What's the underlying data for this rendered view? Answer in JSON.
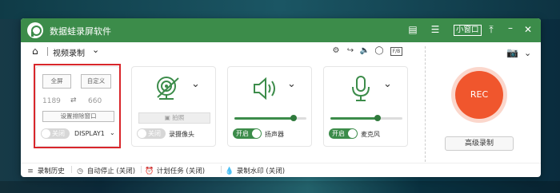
{
  "app": {
    "title": "数据蛙录屏软件",
    "mini_label": "小窗口"
  },
  "titlebar_icons": [
    "message-icon",
    "menu-icon",
    "pin-icon",
    "minimize-icon",
    "close-icon"
  ],
  "mode": {
    "label": "视频录制"
  },
  "toolbar_icons": [
    "settings-icon",
    "export-icon",
    "speaker-icon",
    "mouse-icon",
    "fb-icon"
  ],
  "toolbar_fb": "F/B",
  "screen_card": {
    "fullscreen_label": "全屏",
    "custom_label": "自定义",
    "width": "1189",
    "height": "660",
    "exclude_label": "设置排除窗口",
    "toggle_label": "关闭",
    "display": "DISPLAY1"
  },
  "camera_card": {
    "photo_label": "拍照",
    "toggle_label": "关闭",
    "name": "录摄像头"
  },
  "speaker_card": {
    "toggle_label": "开启",
    "name": "扬声器",
    "volume": 0.82
  },
  "mic_card": {
    "toggle_label": "开启",
    "name": "麦克风",
    "volume": 0.65
  },
  "rec": {
    "label": "REC",
    "advanced_label": "高级录制"
  },
  "statusbar": {
    "history": "录制历史",
    "auto_stop": "自动停止 (关闭)",
    "schedule": "计划任务 (关闭)",
    "watermark": "录制水印 (关闭)"
  },
  "colors": {
    "brand": "#3c8c4a",
    "rec": "#f0562d",
    "highlight": "#d9262b"
  }
}
